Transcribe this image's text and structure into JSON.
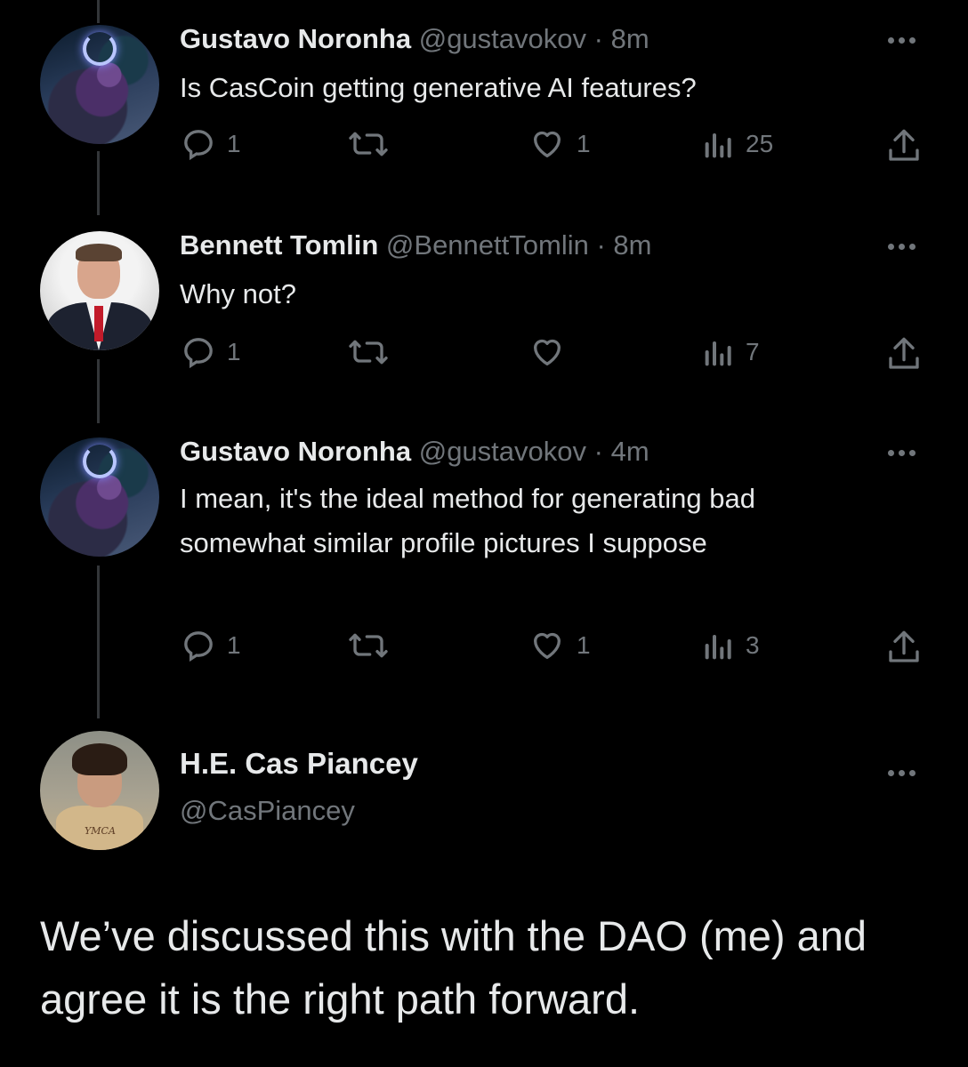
{
  "tweets": [
    {
      "name": "Gustavo Noronha",
      "handle": "@gustavokov",
      "separator": "·",
      "time": "8m",
      "text": "Is CasCoin getting generative AI features?",
      "replies": "1",
      "retweets": "",
      "likes": "1",
      "views": "25"
    },
    {
      "name": "Bennett Tomlin",
      "handle": "@BennettTomlin",
      "separator": "·",
      "time": "8m",
      "text": "Why not?",
      "replies": "1",
      "retweets": "",
      "likes": "",
      "views": "7"
    },
    {
      "name": "Gustavo Noronha",
      "handle": "@gustavokov",
      "separator": "·",
      "time": "4m",
      "text": "I mean, it's the ideal method for generating bad somewhat similar profile pictures I suppose",
      "replies": "1",
      "retweets": "",
      "likes": "1",
      "views": "3"
    }
  ],
  "main_tweet": {
    "name": "H.E. Cas Piancey",
    "handle": "@CasPiancey",
    "avatar_jersey_text": "YMCA",
    "text": "We’ve discussed this with the DAO (me) and agree it is the right path forward."
  },
  "icons": {
    "reply": "reply-icon",
    "retweet": "retweet-icon",
    "like": "heart-icon",
    "views": "views-icon",
    "share": "share-icon",
    "more": "more-icon"
  },
  "colors": {
    "background": "#000000",
    "primary_text": "#e7e9ea",
    "secondary_text": "#71767b",
    "thread_line": "#333639"
  }
}
